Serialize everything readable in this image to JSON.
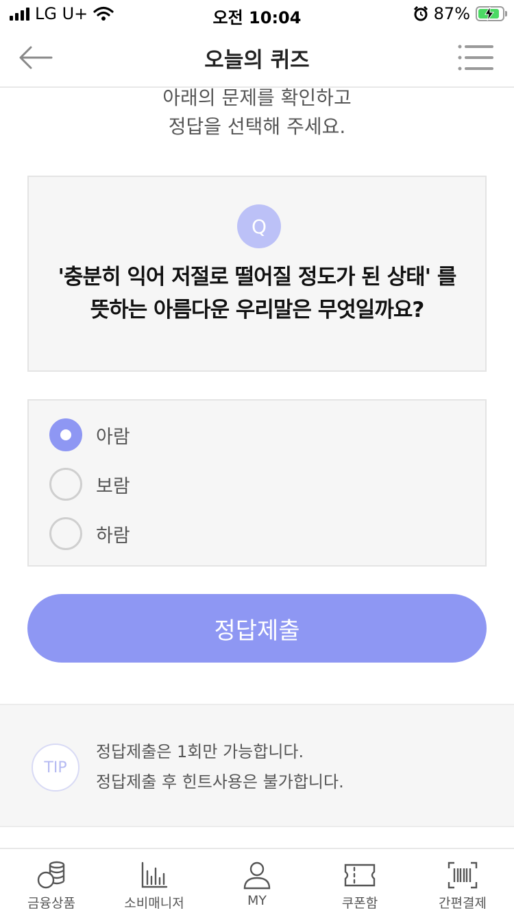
{
  "status_bar": {
    "carrier": "LG U+",
    "time": "오전 10:04",
    "battery": "87%",
    "battery_level": 0.87
  },
  "header": {
    "title": "오늘의 퀴즈"
  },
  "intro": {
    "line1": "아래의 문제를 확인하고",
    "line2": "정답을 선택해 주세요."
  },
  "question": {
    "badge": "Q",
    "line1": "'충분히 익어 저절로 떨어질 정도가 된 상태' 를",
    "line2": "뜻하는 아름다운 우리말은 무엇일까요?"
  },
  "options": [
    {
      "label": "아람",
      "selected": true
    },
    {
      "label": "보람",
      "selected": false
    },
    {
      "label": "하람",
      "selected": false
    }
  ],
  "submit": {
    "label": "정답제출"
  },
  "tip": {
    "badge": "TIP",
    "line1": "정답제출은 1회만 가능합니다.",
    "line2": "정답제출 후 힌트사용은 불가합니다."
  },
  "bottom_nav": [
    {
      "label": "금융상품",
      "icon": "coins-icon"
    },
    {
      "label": "소비매니저",
      "icon": "bar-chart-icon"
    },
    {
      "label": "MY",
      "icon": "person-icon"
    },
    {
      "label": "쿠폰함",
      "icon": "ticket-icon"
    },
    {
      "label": "간편결제",
      "icon": "barcode-icon"
    }
  ],
  "colors": {
    "accent": "#8e97f3",
    "badge": "#bcc1f7",
    "card_bg": "#f6f6f6"
  }
}
